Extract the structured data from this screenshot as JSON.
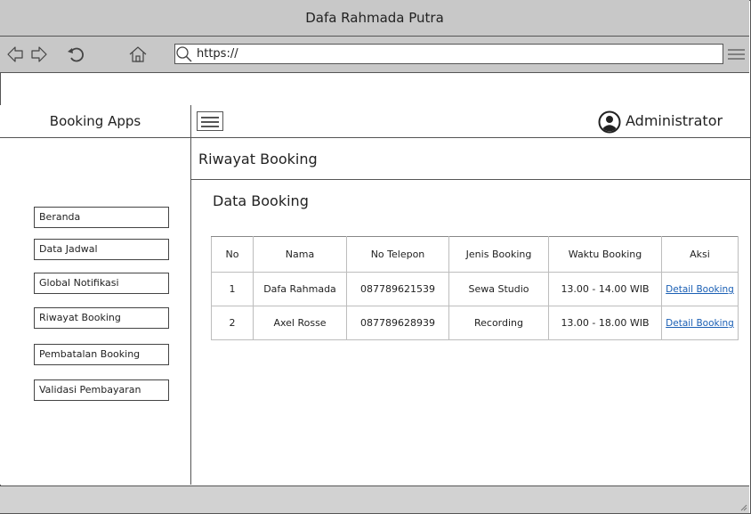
{
  "window": {
    "title": "Dafa Rahmada Putra"
  },
  "browser": {
    "url": "https://",
    "icons": [
      "back-icon",
      "forward-icon",
      "reload-icon",
      "home-icon",
      "search-icon",
      "menu-icon"
    ]
  },
  "sidebar": {
    "title": "Booking Apps",
    "items": [
      {
        "label": "Beranda"
      },
      {
        "label": "Data Jadwal"
      },
      {
        "label": "Global Notifikasi"
      },
      {
        "label": "Riwayat Booking"
      },
      {
        "label": "Pembatalan Booking"
      },
      {
        "label": "Validasi Pembayaran"
      }
    ]
  },
  "header": {
    "user": "Administrator"
  },
  "page": {
    "title": "Riwayat Booking",
    "section": "Data Booking"
  },
  "table": {
    "columns": [
      "No",
      "Nama",
      "No Telepon",
      "Jenis Booking",
      "Waktu Booking",
      "Aksi"
    ],
    "rows": [
      {
        "no": "1",
        "nama": "Dafa Rahmada",
        "telepon": "087789621539",
        "jenis": "Sewa Studio",
        "waktu": "13.00 - 14.00 WIB",
        "aksi": "Detail Booking"
      },
      {
        "no": "2",
        "nama": "Axel Rosse",
        "telepon": "087789628939",
        "jenis": "Recording",
        "waktu": "13.00 - 18.00 WIB",
        "aksi": "Detail Booking"
      }
    ]
  },
  "colors": {
    "chrome": "#c8c8c8",
    "border": "#555555",
    "link": "#1a5fb4"
  }
}
